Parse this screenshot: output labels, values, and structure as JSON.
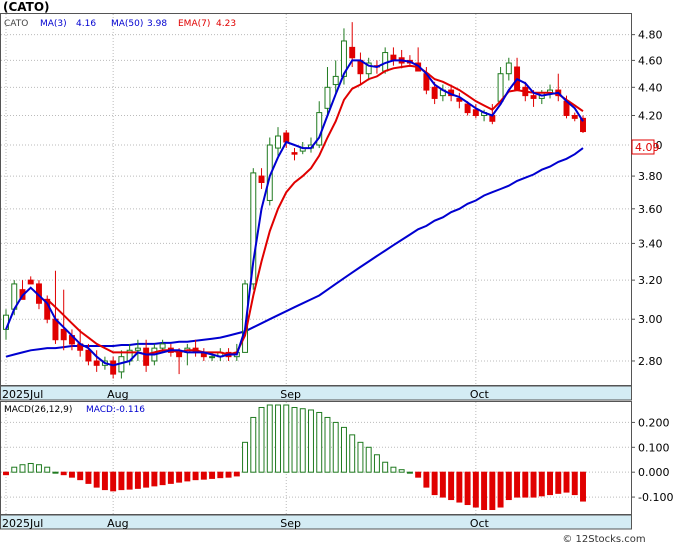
{
  "header": {
    "symbol": "(CATO)"
  },
  "legend": {
    "ticker": "CATO",
    "ma3_label": "MA(3)",
    "ma3_value": "4.16",
    "ma50_label": "MA(50)",
    "ma50_value": "3.98",
    "ema7_label": "EMA(7)",
    "ema7_value": "4.23"
  },
  "macd_legend": {
    "label": "MACD(26,12,9)",
    "value_label": "MACD:-0.116"
  },
  "last_price_label": "4.09",
  "watermark": "© 12Stocks.com",
  "colors": {
    "up": "#1f7a1f",
    "down": "#e00000",
    "ma": "#0000d0",
    "ema": "#e00000",
    "axis_band": "#d4ecf4",
    "grid": "#bbbbbb"
  },
  "chart_data": [
    {
      "type": "candlestick",
      "title": "(CATO)",
      "x_labels": [
        {
          "label": "2025Jul",
          "index": 0
        },
        {
          "label": "Aug",
          "index": 13
        },
        {
          "label": "Sep",
          "index": 34
        },
        {
          "label": "Oct",
          "index": 57
        }
      ],
      "y_ticks": [
        2.8,
        3.0,
        3.2,
        3.4,
        3.6,
        3.8,
        4.0,
        4.2,
        4.4,
        4.6,
        4.8
      ],
      "y_tick_labels": [
        "2.80",
        "3.00",
        "3.20",
        "3.40",
        "3.60",
        "3.80",
        "4.00",
        "4.20",
        "4.40",
        "4.60",
        "4.80"
      ],
      "ylim": [
        2.7,
        4.95
      ],
      "scale": "log",
      "ohlc": [
        [
          2.95,
          3.05,
          2.9,
          3.02
        ],
        [
          3.05,
          3.2,
          3.02,
          3.18
        ],
        [
          3.15,
          3.2,
          3.1,
          3.1
        ],
        [
          3.2,
          3.22,
          3.18,
          3.18
        ],
        [
          3.18,
          3.2,
          3.05,
          3.08
        ],
        [
          3.1,
          3.12,
          2.98,
          3.0
        ],
        [
          3.0,
          3.25,
          2.88,
          2.9
        ],
        [
          2.95,
          3.15,
          2.85,
          2.9
        ],
        [
          2.92,
          2.95,
          2.85,
          2.88
        ],
        [
          2.88,
          2.95,
          2.82,
          2.85
        ],
        [
          2.85,
          2.88,
          2.78,
          2.8
        ],
        [
          2.8,
          2.85,
          2.75,
          2.78
        ],
        [
          2.78,
          2.82,
          2.76,
          2.8
        ],
        [
          2.8,
          2.82,
          2.72,
          2.74
        ],
        [
          2.75,
          2.85,
          2.72,
          2.82
        ],
        [
          2.8,
          2.88,
          2.78,
          2.85
        ],
        [
          2.85,
          2.9,
          2.8,
          2.86
        ],
        [
          2.86,
          2.9,
          2.75,
          2.78
        ],
        [
          2.8,
          2.88,
          2.78,
          2.86
        ],
        [
          2.86,
          2.9,
          2.84,
          2.88
        ],
        [
          2.86,
          2.88,
          2.82,
          2.84
        ],
        [
          2.84,
          2.86,
          2.74,
          2.82
        ],
        [
          2.84,
          2.88,
          2.78,
          2.86
        ],
        [
          2.86,
          2.9,
          2.82,
          2.84
        ],
        [
          2.84,
          2.86,
          2.8,
          2.82
        ],
        [
          2.82,
          2.84,
          2.8,
          2.82
        ],
        [
          2.82,
          2.86,
          2.8,
          2.84
        ],
        [
          2.84,
          2.86,
          2.8,
          2.82
        ],
        [
          2.82,
          2.88,
          2.8,
          2.84
        ],
        [
          2.84,
          3.2,
          2.84,
          3.18
        ],
        [
          3.18,
          3.85,
          3.15,
          3.82
        ],
        [
          3.8,
          3.85,
          3.72,
          3.76
        ],
        [
          3.65,
          4.05,
          3.62,
          4.0
        ],
        [
          3.98,
          4.12,
          3.92,
          4.06
        ],
        [
          4.08,
          4.1,
          3.98,
          4.02
        ],
        [
          3.95,
          3.98,
          3.9,
          3.94
        ],
        [
          3.96,
          4.02,
          3.94,
          3.98
        ],
        [
          3.98,
          4.05,
          3.95,
          4.0
        ],
        [
          4.0,
          4.3,
          3.98,
          4.22
        ],
        [
          4.25,
          4.55,
          4.2,
          4.4
        ],
        [
          4.42,
          4.6,
          4.35,
          4.48
        ],
        [
          4.48,
          4.85,
          4.42,
          4.75
        ],
        [
          4.7,
          4.9,
          4.55,
          4.62
        ],
        [
          4.6,
          4.66,
          4.42,
          4.5
        ],
        [
          4.5,
          4.62,
          4.45,
          4.58
        ],
        [
          4.56,
          4.6,
          4.5,
          4.55
        ],
        [
          4.52,
          4.7,
          4.5,
          4.66
        ],
        [
          4.64,
          4.7,
          4.56,
          4.6
        ],
        [
          4.62,
          4.68,
          4.54,
          4.58
        ],
        [
          4.6,
          4.64,
          4.55,
          4.58
        ],
        [
          4.58,
          4.7,
          4.52,
          4.52
        ],
        [
          4.5,
          4.55,
          4.35,
          4.38
        ],
        [
          4.4,
          4.44,
          4.28,
          4.32
        ],
        [
          4.34,
          4.42,
          4.3,
          4.38
        ],
        [
          4.38,
          4.42,
          4.3,
          4.34
        ],
        [
          4.32,
          4.36,
          4.25,
          4.3
        ],
        [
          4.28,
          4.3,
          4.2,
          4.22
        ],
        [
          4.24,
          4.28,
          4.18,
          4.2
        ],
        [
          4.2,
          4.24,
          4.16,
          4.22
        ],
        [
          4.2,
          4.28,
          4.14,
          4.16
        ],
        [
          4.3,
          4.55,
          4.28,
          4.5
        ],
        [
          4.5,
          4.62,
          4.45,
          4.58
        ],
        [
          4.55,
          4.62,
          4.42,
          4.38
        ],
        [
          4.4,
          4.44,
          4.3,
          4.34
        ],
        [
          4.34,
          4.38,
          4.26,
          4.32
        ],
        [
          4.32,
          4.38,
          4.28,
          4.36
        ],
        [
          4.36,
          4.42,
          4.32,
          4.38
        ],
        [
          4.38,
          4.5,
          4.3,
          4.34
        ],
        [
          4.3,
          4.34,
          4.18,
          4.2
        ],
        [
          4.2,
          4.22,
          4.16,
          4.18
        ],
        [
          4.18,
          4.2,
          4.08,
          4.09
        ]
      ],
      "ma3": [
        2.95,
        3.05,
        3.12,
        3.16,
        3.12,
        3.08,
        3.0,
        2.96,
        2.92,
        2.88,
        2.86,
        2.82,
        2.79,
        2.78,
        2.79,
        2.8,
        2.84,
        2.83,
        2.83,
        2.84,
        2.85,
        2.85,
        2.84,
        2.84,
        2.84,
        2.83,
        2.82,
        2.83,
        2.83,
        2.95,
        3.3,
        3.6,
        3.8,
        3.92,
        4.02,
        4.0,
        3.98,
        3.98,
        4.05,
        4.2,
        4.35,
        4.5,
        4.6,
        4.6,
        4.56,
        4.55,
        4.58,
        4.6,
        4.6,
        4.59,
        4.56,
        4.5,
        4.42,
        4.38,
        4.35,
        4.33,
        4.29,
        4.25,
        4.22,
        4.2,
        4.28,
        4.38,
        4.46,
        4.43,
        4.36,
        4.34,
        4.35,
        4.36,
        4.3,
        4.25,
        4.16
      ],
      "ma50": [
        2.82,
        2.83,
        2.84,
        2.85,
        2.855,
        2.86,
        2.86,
        2.865,
        2.87,
        2.87,
        2.87,
        2.87,
        2.87,
        2.87,
        2.875,
        2.875,
        2.88,
        2.88,
        2.88,
        2.885,
        2.885,
        2.89,
        2.89,
        2.895,
        2.9,
        2.905,
        2.91,
        2.92,
        2.93,
        2.94,
        2.96,
        2.98,
        3.0,
        3.02,
        3.04,
        3.06,
        3.08,
        3.1,
        3.12,
        3.15,
        3.18,
        3.21,
        3.24,
        3.27,
        3.3,
        3.33,
        3.36,
        3.39,
        3.42,
        3.45,
        3.48,
        3.5,
        3.53,
        3.55,
        3.58,
        3.6,
        3.63,
        3.65,
        3.68,
        3.7,
        3.72,
        3.74,
        3.77,
        3.79,
        3.81,
        3.84,
        3.86,
        3.89,
        3.91,
        3.94,
        3.98
      ],
      "ema7": [
        null,
        null,
        null,
        null,
        null,
        3.1,
        3.06,
        3.02,
        2.98,
        2.94,
        2.91,
        2.88,
        2.86,
        2.84,
        2.84,
        2.84,
        2.84,
        2.83,
        2.84,
        2.85,
        2.85,
        2.84,
        2.85,
        2.85,
        2.84,
        2.84,
        2.84,
        2.83,
        2.84,
        2.92,
        3.12,
        3.3,
        3.47,
        3.6,
        3.7,
        3.76,
        3.8,
        3.85,
        3.93,
        4.05,
        4.16,
        4.31,
        4.39,
        4.42,
        4.46,
        4.48,
        4.52,
        4.54,
        4.55,
        4.56,
        4.55,
        4.51,
        4.46,
        4.44,
        4.41,
        4.38,
        4.34,
        4.3,
        4.27,
        4.24,
        4.3,
        4.37,
        4.38,
        4.37,
        4.36,
        4.36,
        4.36,
        4.35,
        4.31,
        4.27,
        4.23
      ]
    },
    {
      "type": "bar",
      "title": "MACD(26,12,9)",
      "y_ticks": [
        -0.1,
        0.0,
        0.1,
        0.2
      ],
      "y_tick_labels": [
        "-0.100",
        "0.000",
        "0.100",
        "0.200"
      ],
      "ylim": [
        -0.16,
        0.27
      ],
      "values": [
        -0.01,
        0.02,
        0.03,
        0.035,
        0.03,
        0.02,
        0.0,
        -0.01,
        -0.02,
        -0.03,
        -0.045,
        -0.06,
        -0.07,
        -0.075,
        -0.07,
        -0.068,
        -0.065,
        -0.06,
        -0.055,
        -0.05,
        -0.045,
        -0.04,
        -0.035,
        -0.03,
        -0.028,
        -0.025,
        -0.022,
        -0.02,
        -0.015,
        0.12,
        0.22,
        0.26,
        0.27,
        0.27,
        0.27,
        0.26,
        0.255,
        0.25,
        0.24,
        0.22,
        0.2,
        0.18,
        0.15,
        0.12,
        0.1,
        0.07,
        0.04,
        0.02,
        0.01,
        0.0,
        -0.02,
        -0.06,
        -0.09,
        -0.1,
        -0.11,
        -0.12,
        -0.13,
        -0.14,
        -0.15,
        -0.15,
        -0.14,
        -0.11,
        -0.1,
        -0.1,
        -0.1,
        -0.095,
        -0.09,
        -0.085,
        -0.08,
        -0.09,
        -0.116
      ]
    }
  ]
}
